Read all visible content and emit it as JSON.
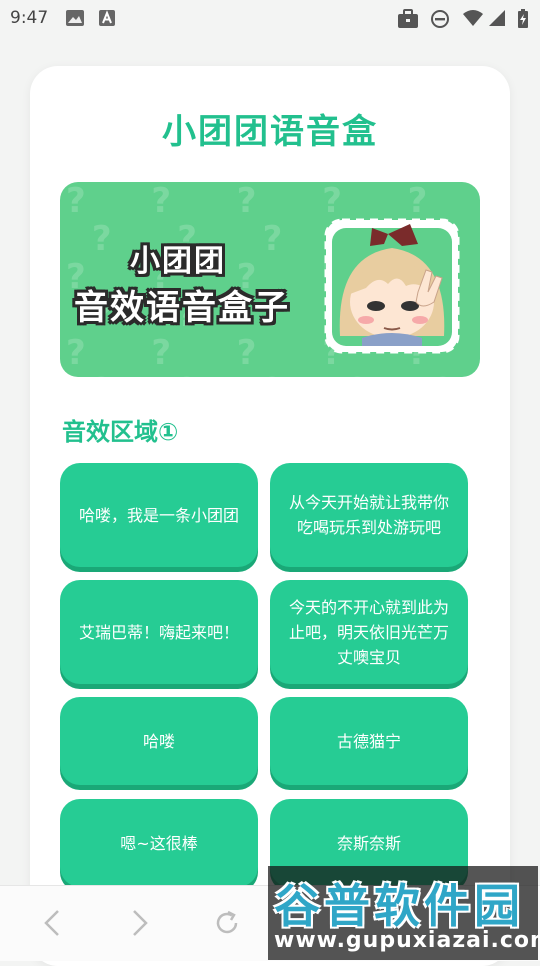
{
  "status": {
    "time": "9:47",
    "icons": [
      "image-icon",
      "text-a-icon",
      "briefcase-icon",
      "do-not-disturb-icon",
      "wifi-icon",
      "signal-icon",
      "battery-charging-icon"
    ]
  },
  "app": {
    "title": "小团团语音盒",
    "banner": {
      "line1": "小团团",
      "line2": "音效语音盒子",
      "pattern_char": "?"
    },
    "section_title": "音效区域①",
    "buttons": [
      "哈喽，我是一条小团团",
      "从今天开始就让我带你吃喝玩乐到处游玩吧",
      "艾瑞巴蒂！嗨起来吧！",
      "今天的不开心就到此为止吧，明天依旧光芒万丈噢宝贝",
      "哈喽",
      "古德猫宁",
      "嗯~这很棒",
      "奈斯奈斯"
    ]
  },
  "nav": {
    "icons": [
      "back-icon",
      "forward-icon",
      "refresh-icon"
    ]
  },
  "watermark": {
    "text_big": "谷普软件园",
    "text_small": "www.gupuxiazai.com"
  },
  "colors": {
    "accent": "#22c08e",
    "button": "#26cc94",
    "button_shadow": "#1aa877",
    "banner": "#5fd08c"
  }
}
